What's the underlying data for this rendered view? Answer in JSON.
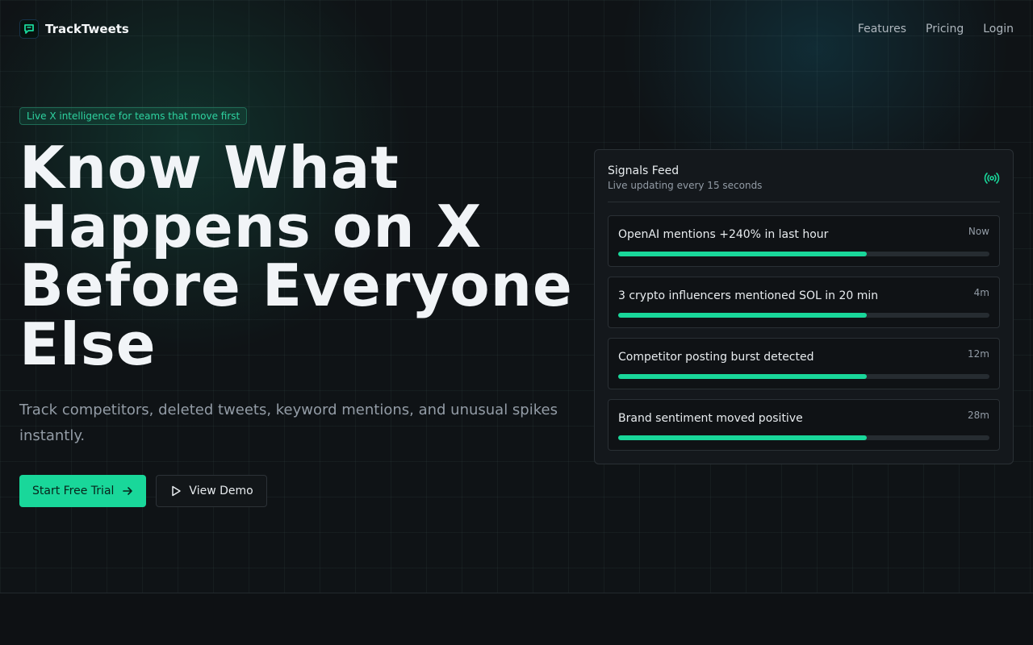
{
  "brand": {
    "name": "TrackTweets",
    "accent": "#19d79a"
  },
  "nav": {
    "links": [
      "Features",
      "Pricing",
      "Login"
    ]
  },
  "hero": {
    "pill": "Live X intelligence for teams that move first",
    "headline_lines": [
      "Know What",
      "Happens on X",
      "Before Everyone",
      "Else"
    ],
    "subtitle": "Track competitors, deleted tweets, keyword mentions, and unusual spikes instantly.",
    "primary_cta": "Start Free Trial",
    "secondary_cta": "View Demo"
  },
  "feed": {
    "title": "Signals Feed",
    "subtitle": "Live updating every 15 seconds",
    "signals": [
      {
        "text": "OpenAI mentions +240% in last hour",
        "time": "Now",
        "level": 0.67
      },
      {
        "text": "3 crypto influencers mentioned SOL in 20 min",
        "time": "4m",
        "level": 0.67
      },
      {
        "text": "Competitor posting burst detected",
        "time": "12m",
        "level": 0.67
      },
      {
        "text": "Brand sentiment moved positive",
        "time": "28m",
        "level": 0.67
      }
    ]
  },
  "icons": {
    "logo": "chat-bubble-icon",
    "primary_cta": "arrow-right-icon",
    "secondary_cta": "play-icon",
    "feed": "broadcast-icon"
  }
}
